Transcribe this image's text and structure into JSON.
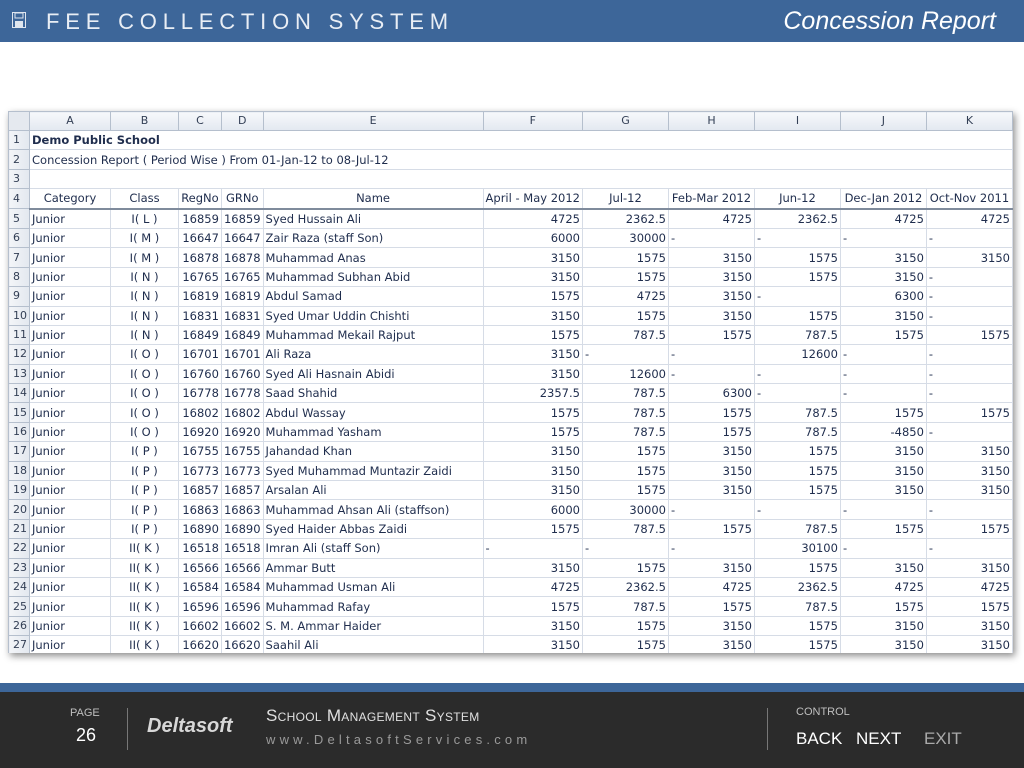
{
  "header": {
    "app_title": "FEE COLLECTION SYSTEM",
    "slide_title": "Concession Report",
    "app_icon": "floppy-disk-icon"
  },
  "sheet": {
    "columns": [
      "A",
      "B",
      "C",
      "D",
      "E",
      "F",
      "G",
      "H",
      "I",
      "J",
      "K"
    ],
    "school_name": "Demo Public School",
    "report_title": "Concession Report ( Period Wise  ) From 01-Jan-12 to 08-Jul-12",
    "table_headers": [
      "Category",
      "Class",
      "RegNo",
      "GRNo",
      "Name",
      "April - May 2012",
      "Jul-12",
      "Feb-Mar 2012",
      "Jun-12",
      "Dec-Jan 2012",
      "Oct-Nov 2011"
    ],
    "rows": [
      [
        "Junior",
        "I( L )",
        "16859",
        "16859",
        "Syed Hussain Ali",
        "4725",
        "2362.5",
        "4725",
        "2362.5",
        "4725",
        "4725"
      ],
      [
        "Junior",
        "I( M )",
        "16647",
        "16647",
        "Zair Raza (staff Son)",
        "6000",
        "30000",
        "-",
        "-",
        "-",
        "-"
      ],
      [
        "Junior",
        "I( M )",
        "16878",
        "16878",
        "Muhammad Anas",
        "3150",
        "1575",
        "3150",
        "1575",
        "3150",
        "3150"
      ],
      [
        "Junior",
        "I( N )",
        "16765",
        "16765",
        "Muhammad Subhan Abid",
        "3150",
        "1575",
        "3150",
        "1575",
        "3150",
        "-"
      ],
      [
        "Junior",
        "I( N )",
        "16819",
        "16819",
        "Abdul Samad",
        "1575",
        "4725",
        "3150",
        "-",
        "6300",
        "-"
      ],
      [
        "Junior",
        "I( N )",
        "16831",
        "16831",
        "Syed Umar Uddin Chishti",
        "3150",
        "1575",
        "3150",
        "1575",
        "3150",
        "-"
      ],
      [
        "Junior",
        "I( N )",
        "16849",
        "16849",
        "Muhammad Mekail Rajput",
        "1575",
        "787.5",
        "1575",
        "787.5",
        "1575",
        "1575"
      ],
      [
        "Junior",
        "I( O )",
        "16701",
        "16701",
        "Ali Raza",
        "3150",
        "-",
        "-",
        "12600",
        "-",
        "-"
      ],
      [
        "Junior",
        "I( O )",
        "16760",
        "16760",
        "Syed Ali Hasnain Abidi",
        "3150",
        "12600",
        "-",
        "-",
        "-",
        "-"
      ],
      [
        "Junior",
        "I( O )",
        "16778",
        "16778",
        "Saad Shahid",
        "2357.5",
        "787.5",
        "6300",
        "-",
        "-",
        "-"
      ],
      [
        "Junior",
        "I( O )",
        "16802",
        "16802",
        "Abdul Wassay",
        "1575",
        "787.5",
        "1575",
        "787.5",
        "1575",
        "1575"
      ],
      [
        "Junior",
        "I( O )",
        "16920",
        "16920",
        "Muhammad Yasham",
        "1575",
        "787.5",
        "1575",
        "787.5",
        "-4850",
        "-"
      ],
      [
        "Junior",
        "I( P )",
        "16755",
        "16755",
        "Jahandad Khan",
        "3150",
        "1575",
        "3150",
        "1575",
        "3150",
        "3150"
      ],
      [
        "Junior",
        "I( P )",
        "16773",
        "16773",
        "Syed Muhammad Muntazir Zaidi",
        "3150",
        "1575",
        "3150",
        "1575",
        "3150",
        "3150"
      ],
      [
        "Junior",
        "I( P )",
        "16857",
        "16857",
        "Arsalan Ali",
        "3150",
        "1575",
        "3150",
        "1575",
        "3150",
        "3150"
      ],
      [
        "Junior",
        "I( P )",
        "16863",
        "16863",
        "Muhammad Ahsan Ali (staffson)",
        "6000",
        "30000",
        "-",
        "-",
        "-",
        "-"
      ],
      [
        "Junior",
        "I( P )",
        "16890",
        "16890",
        "Syed Haider Abbas Zaidi",
        "1575",
        "787.5",
        "1575",
        "787.5",
        "1575",
        "1575"
      ],
      [
        "Junior",
        "II( K )",
        "16518",
        "16518",
        "Imran Ali (staff Son)",
        "-",
        "-",
        "-",
        "30100",
        "-",
        "-"
      ],
      [
        "Junior",
        "II( K )",
        "16566",
        "16566",
        "Ammar Butt",
        "3150",
        "1575",
        "3150",
        "1575",
        "3150",
        "3150"
      ],
      [
        "Junior",
        "II( K )",
        "16584",
        "16584",
        "Muhammad Usman Ali",
        "4725",
        "2362.5",
        "4725",
        "2362.5",
        "4725",
        "4725"
      ],
      [
        "Junior",
        "II( K )",
        "16596",
        "16596",
        "Muhammad Rafay",
        "1575",
        "787.5",
        "1575",
        "787.5",
        "1575",
        "1575"
      ],
      [
        "Junior",
        "II( K )",
        "16602",
        "16602",
        "S. M. Ammar Haider",
        "3150",
        "1575",
        "3150",
        "1575",
        "3150",
        "3150"
      ],
      [
        "Junior",
        "II( K )",
        "16620",
        "16620",
        "Saahil Ali",
        "3150",
        "1575",
        "3150",
        "1575",
        "3150",
        "3150"
      ]
    ]
  },
  "footer": {
    "page_label": "PAGE",
    "page_number": "26",
    "brand": "Deltasoft",
    "system_name": "School Management System",
    "system_url": "www.DeltasoftServices.com",
    "control_label": "CONTROL",
    "back_label": "BACK",
    "next_label": "NEXT",
    "exit_label": "EXIT"
  }
}
